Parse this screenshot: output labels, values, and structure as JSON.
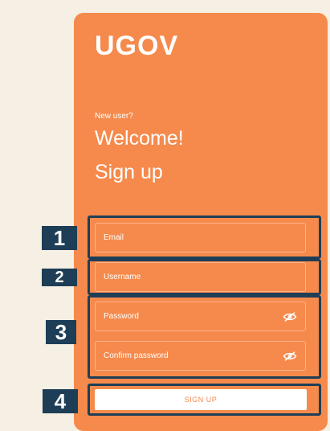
{
  "app": {
    "logo": "UGOV"
  },
  "signup": {
    "prompt": "New user?",
    "welcome": "Welcome!",
    "title": "Sign up",
    "fields": {
      "email": "Email",
      "username": "Username",
      "password": "Password",
      "confirm_password": "Confirm password"
    },
    "button": "SIGN UP"
  },
  "annotations": {
    "one": "1",
    "two": "2",
    "three": "3",
    "four": "4"
  },
  "colors": {
    "background": "#f6efe4",
    "card": "#f58a4c",
    "annotation": "#1e3e57"
  },
  "icons": {
    "password_toggle": "eye-slash-icon"
  }
}
